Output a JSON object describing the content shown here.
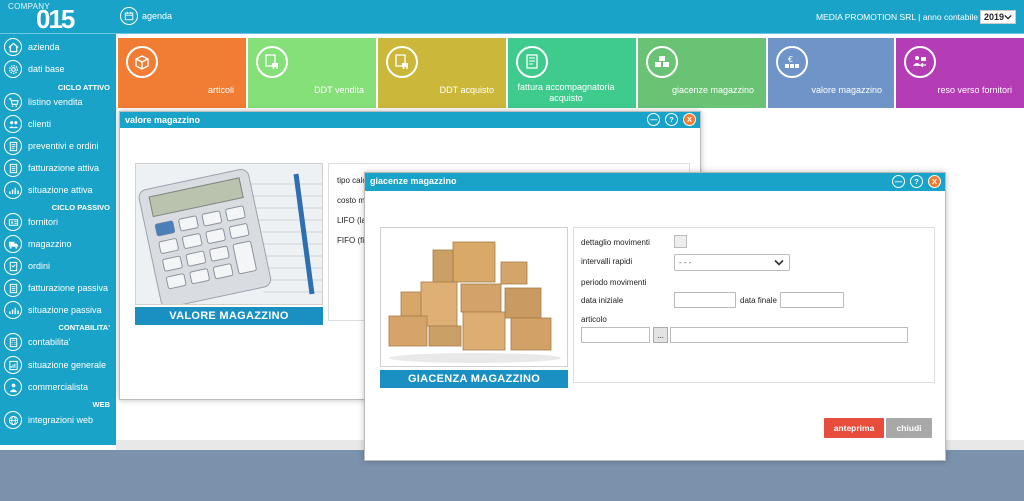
{
  "brand": {
    "company_word": "COMPANY",
    "company_num": "015"
  },
  "topbar": {
    "agenda_label": "agenda",
    "company_info": "MEDIA PROMOTION SRL | anno contabile",
    "year": "2019"
  },
  "sidebar": {
    "items": [
      {
        "label": "azienda"
      },
      {
        "label": "dati base"
      },
      {
        "label": "listino vendita"
      },
      {
        "label": "clienti"
      },
      {
        "label": "preventivi e ordini"
      },
      {
        "label": "fatturazione attiva"
      },
      {
        "label": "situazione attiva"
      },
      {
        "label": "fornitori"
      },
      {
        "label": "magazzino"
      },
      {
        "label": "ordini"
      },
      {
        "label": "fatturazione passiva"
      },
      {
        "label": "situazione passiva"
      },
      {
        "label": "contabilita'"
      },
      {
        "label": "situazione generale"
      },
      {
        "label": "commercialista"
      },
      {
        "label": "integrazioni web"
      }
    ],
    "sections": {
      "ciclo_attivo": "CICLO ATTIVO",
      "ciclo_passivo": "CICLO PASSIVO",
      "contabilita": "CONTABILITA'",
      "web": "WEB"
    }
  },
  "tiles": [
    {
      "label": "articoli",
      "color": "#f07d33"
    },
    {
      "label": "DDT vendita",
      "color": "#86e07a"
    },
    {
      "label": "DDT acquisto",
      "color": "#cbb83a"
    },
    {
      "label": "fattura accompagnatoria acquisto",
      "color": "#3fcb8e"
    },
    {
      "label": "giacenze magazzino",
      "color": "#6ac275"
    },
    {
      "label": "valore magazzino",
      "color": "#6f95c8"
    },
    {
      "label": "reso verso fornitori",
      "color": "#b43cb4"
    }
  ],
  "panel_valore": {
    "title": "valore magazzino",
    "caption": "VALORE MAGAZZINO",
    "fields": [
      "tipo calc",
      "costo m",
      "LIFO (la",
      "FIFO (fir"
    ]
  },
  "panel_giacenze": {
    "title": "giacenze magazzino",
    "caption": "GIACENZA MAGAZZINO",
    "labels": {
      "dettaglio": "dettaglio movimenti",
      "intervalli": "intervalli rapidi",
      "periodo": "periodo movimenti",
      "data_iniziale": "data iniziale",
      "data_finale": "data finale",
      "articolo": "articolo"
    },
    "intervalli_value": "- - -",
    "lookup_label": "...",
    "buttons": {
      "preview": "anteprima",
      "close": "chiudi"
    }
  },
  "window_buttons": {
    "min": "—",
    "help": "?",
    "close": "X"
  },
  "colors": {
    "primary": "#1aa3c8",
    "caption": "#1a8fc2",
    "danger": "#e74c3c",
    "footer": "#7b92ad"
  }
}
